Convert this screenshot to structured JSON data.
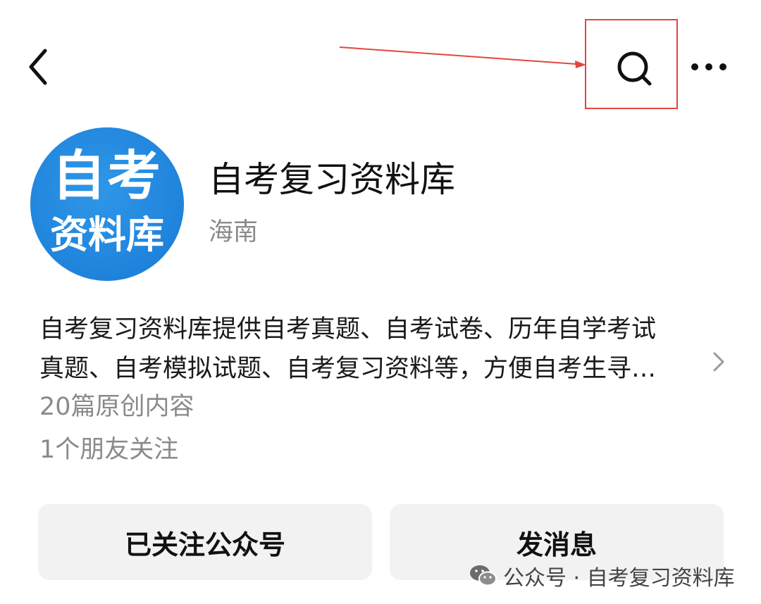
{
  "topbar": {
    "back_icon": "chevron-left-icon",
    "search_icon": "search-icon",
    "more_icon": "more-horizontal-icon",
    "highlight_color": "#e2463f"
  },
  "profile": {
    "avatar": {
      "line1": "自考",
      "line2": "资料库",
      "color": "#1f83db"
    },
    "name": "自考复习资料库",
    "region": "海南"
  },
  "description": {
    "line1": "自考复习资料库提供自考真题、自考试卷、历年自学考试",
    "line2": "真题、自考模拟试题、自考复习资料等，方便自考生寻…"
  },
  "stats": {
    "articles": "20篇原创内容",
    "friends": "1个朋友关注"
  },
  "actions": {
    "follow_label": "已关注公众号",
    "message_label": "发消息"
  },
  "watermark": {
    "text": "公众号 · 自考复习资料库"
  }
}
